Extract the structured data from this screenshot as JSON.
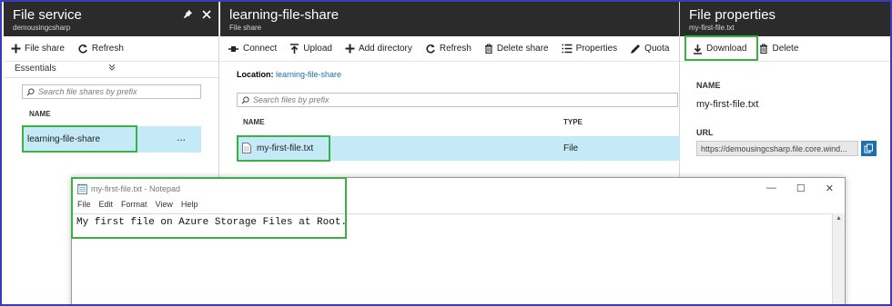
{
  "blade1": {
    "title": "File service",
    "subtitle": "demousingcsharp",
    "toolbar": {
      "file_share": "File share",
      "refresh": "Refresh"
    },
    "essentials": "Essentials",
    "search_placeholder": "Search file shares by prefix",
    "column_name": "NAME",
    "share_name": "learning-file-share",
    "more": "..."
  },
  "blade2": {
    "title": "learning-file-share",
    "subtitle": "File share",
    "toolbar": {
      "connect": "Connect",
      "upload": "Upload",
      "add_directory": "Add directory",
      "refresh": "Refresh",
      "delete_share": "Delete share",
      "properties": "Properties",
      "quota": "Quota"
    },
    "location_label": "Location:",
    "location_value": "learning-file-share",
    "search_placeholder": "Search files by prefix",
    "column_name": "NAME",
    "column_type": "TYPE",
    "file_name": "my-first-file.txt",
    "file_type": "File"
  },
  "blade3": {
    "title": "File properties",
    "subtitle": "my-first-file.txt",
    "toolbar": {
      "download": "Download",
      "delete": "Delete"
    },
    "name_label": "NAME",
    "name_value": "my-first-file.txt",
    "url_label": "URL",
    "url_value": "https://demousingcsharp.file.core.wind..."
  },
  "notepad": {
    "title": "my-first-file.txt - Notepad",
    "menu": [
      "File",
      "Edit",
      "Format",
      "View",
      "Help"
    ],
    "content": "My first file on Azure Storage Files at Root."
  },
  "colors": {
    "header_bg": "#2b2b2b",
    "selection": "#c4e9f7",
    "highlight_green": "#3cb043",
    "link": "#1c6fb0",
    "frame_border": "#3b3bb5"
  }
}
